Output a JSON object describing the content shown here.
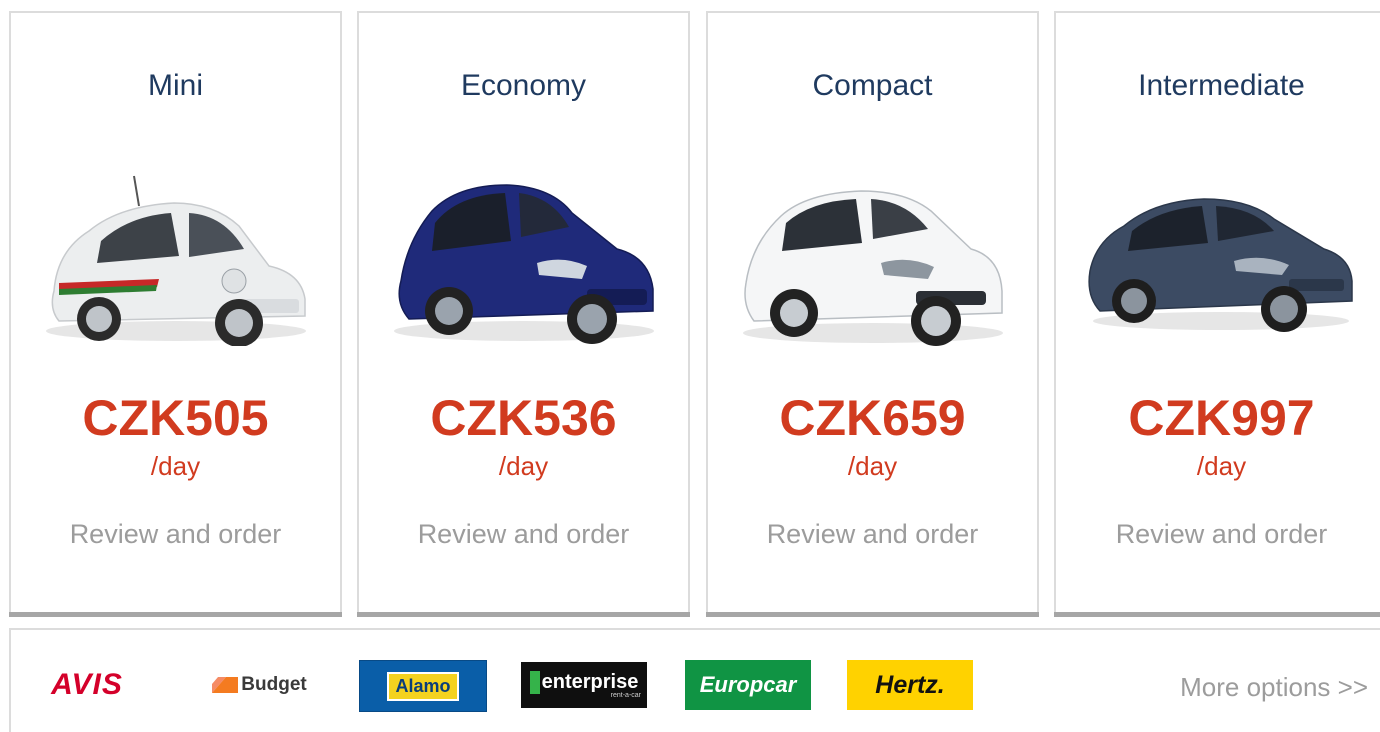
{
  "cards": [
    {
      "category": "Mini",
      "price": "CZK505",
      "per": "/day",
      "cta": "Review and order",
      "car_color": "#e9ebec",
      "car_icon": "white-fiat-500-car"
    },
    {
      "category": "Economy",
      "price": "CZK536",
      "per": "/day",
      "cta": "Review and order",
      "car_color": "#1f2a7a",
      "car_icon": "blue-hatchback-car"
    },
    {
      "category": "Compact",
      "price": "CZK659",
      "per": "/day",
      "cta": "Review and order",
      "car_color": "#f2f3f4",
      "car_icon": "white-compact-car"
    },
    {
      "category": "Intermediate",
      "price": "CZK997",
      "per": "/day",
      "cta": "Review and order",
      "car_color": "#3c4b63",
      "car_icon": "dark-blue-sedan-car"
    }
  ],
  "brands": {
    "avis": "AVIS",
    "budget": "Budget",
    "alamo": "Alamo",
    "enterprise": "enterprise",
    "enterprise_sub": "rent-a-car",
    "europcar": "Europcar",
    "hertz": "Hertz."
  },
  "more_options": "More options >>",
  "colors": {
    "price": "#d13b1f",
    "category": "#1f3a5f",
    "muted": "#9c9c9c"
  }
}
